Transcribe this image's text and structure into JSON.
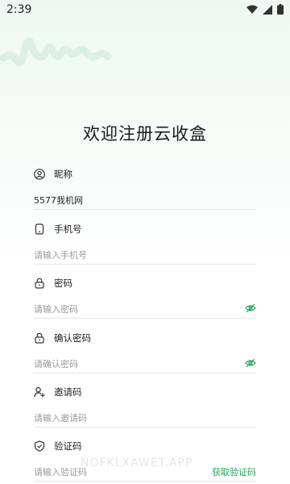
{
  "status_bar": {
    "time": "2:39"
  },
  "page": {
    "title": "欢迎注册云收盒"
  },
  "fields": [
    {
      "icon": "user-icon",
      "label": "昵称",
      "value": "5577我机网",
      "placeholder": ""
    },
    {
      "icon": "phone-icon",
      "label": "手机号",
      "value": "",
      "placeholder": "请输入手机号"
    },
    {
      "icon": "lock-icon",
      "label": "密码",
      "value": "",
      "placeholder": "请输入密码"
    },
    {
      "icon": "lock-icon",
      "label": "确认密码",
      "value": "",
      "placeholder": "请确认密码"
    },
    {
      "icon": "add-user-icon",
      "label": "邀请码",
      "value": "",
      "placeholder": "请输入邀请码"
    },
    {
      "icon": "shield-icon",
      "label": "验证码",
      "value": "",
      "placeholder": "请输入验证码"
    }
  ],
  "get_code_label": "获取验证码",
  "watermark": "NOFKLXAWET.APP",
  "colors": {
    "accent": "#27a35a",
    "background_top": "#eef8f1"
  }
}
